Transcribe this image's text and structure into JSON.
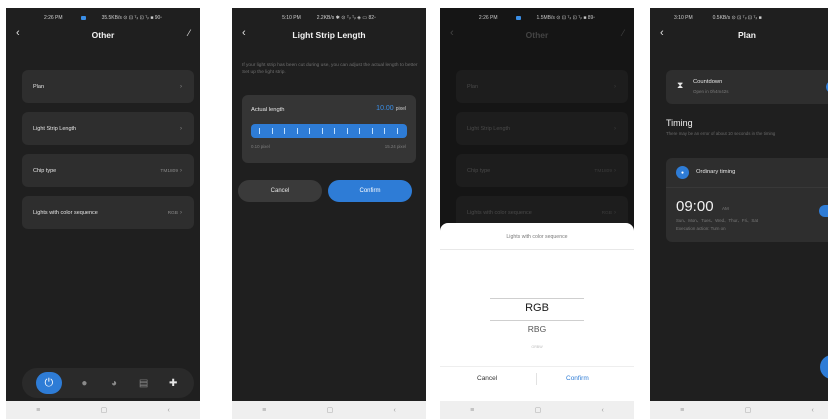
{
  "sys_nav": {
    "menu": "≡",
    "home": "▢",
    "back": "‹"
  },
  "phone1": {
    "status": {
      "time": "2:26 PM",
      "net": "35.5KB/s ⊙ ⊡ ᵀᵢₗ ⊡ ᵀᵢₗ ■ 90▫"
    },
    "title": "Other",
    "back": "‹",
    "edit": "⁄",
    "rows": [
      {
        "label": "Plan",
        "value": "",
        "chev": "›"
      },
      {
        "label": "Light Strip Length",
        "value": "",
        "chev": "›"
      },
      {
        "label": "Chip type",
        "value": "TM1809",
        "chev": "›"
      },
      {
        "label": "Lights with color sequence",
        "value": "RGB",
        "chev": "›"
      }
    ],
    "nav_icons": [
      "⏻",
      "●",
      "◕",
      "▤",
      "✚"
    ]
  },
  "phone2": {
    "status": {
      "time": "5:10 PM",
      "net": "2.2KB/s ✱ ⊙ ᵀᵢₗ ᵀᵢₗ ◈ ▭ 82▫"
    },
    "title": "Light Strip Length",
    "back": "‹",
    "hint": "If your light strip has been cut during use, you can adjust the actual length to better Set up the light strip.",
    "label": "Actual length",
    "value": "10.00",
    "unit": "pixel",
    "min": "0.10 pixel",
    "max": "15.24 pixel",
    "fill": 1.0,
    "cancel": "Cancel",
    "confirm": "Confirm"
  },
  "phone3": {
    "status": {
      "time": "2:26 PM",
      "net": "1.5MB/s ⊙ ⊡ ᵀᵢₗ ⊡ ᵀᵢₗ ■ 89▫"
    },
    "title": "Other",
    "back": "‹",
    "edit": "⁄",
    "rows": [
      {
        "label": "Plan",
        "value": "",
        "chev": "›"
      },
      {
        "label": "Light Strip Length",
        "value": "",
        "chev": "›"
      },
      {
        "label": "Chip type",
        "value": "TM1809",
        "chev": "›"
      },
      {
        "label": "Lights with color sequence",
        "value": "RGB",
        "chev": "›"
      }
    ],
    "sheet": {
      "title": "Lights with color sequence",
      "options": [
        "RGB",
        "RBG",
        "GRBW"
      ],
      "cancel": "Cancel",
      "confirm": "Confirm"
    }
  },
  "phone4": {
    "status": {
      "time": "3:10 PM",
      "net": "0.5KB/s ⊙ ⊡ ᵀᵢₗ ⊡ ᵀᵢₗ ■"
    },
    "title": "Plan",
    "back": "‹",
    "countdown": {
      "icon": "⧗",
      "title": "Countdown",
      "sub": "Open in 0h4m42s"
    },
    "timing_title": "Timing",
    "timing_hint": "There may be an error of about 10 seconds in the timing",
    "ordinary": {
      "icon": "●",
      "label": "Ordinary timing",
      "caret": "▲"
    },
    "entry": {
      "time": "09:00",
      "ampm": "AM",
      "days": "Sun、Mon、Tues、Wed、Thur、Fri、Sat",
      "action": "Execution action: Turn on"
    },
    "fab": "+"
  }
}
